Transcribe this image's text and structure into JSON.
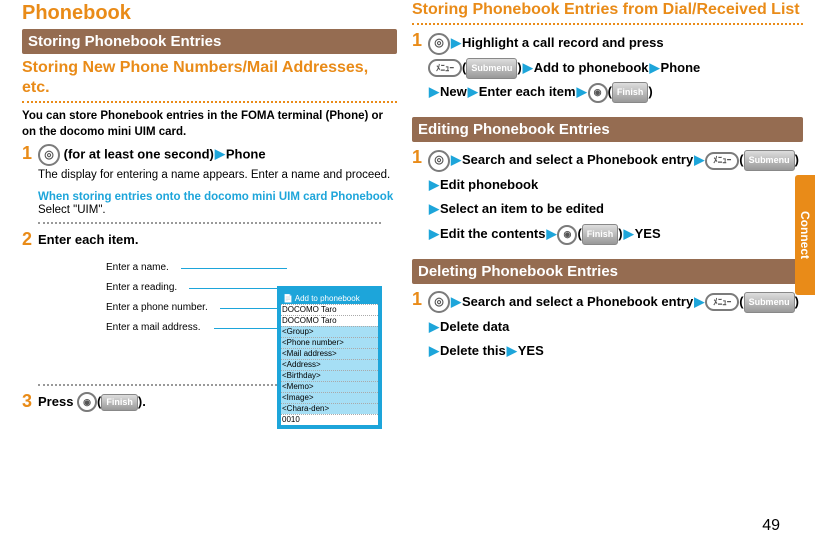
{
  "sidebar_label": "Connect",
  "page_number": "49",
  "left": {
    "h_phonebook": "Phonebook",
    "h_storing": "Storing Phonebook Entries",
    "h_storingnew": "Storing New Phone Numbers/Mail Addresses, etc.",
    "intro": "You can store Phonebook entries in the FOMA terminal (Phone) or on the docomo mini UIM card.",
    "step1_a": "(for at least one second)",
    "step1_b": "Phone",
    "step1_note": "The display for entering a name appears. Enter a name and proceed.",
    "bluehead": "When storing entries onto the docomo mini UIM card Phonebook",
    "bluenote": "Select \"UIM\".",
    "step2": "Enter each item.",
    "step3_a": "Press",
    "step3_b": "(",
    "step3_c": ").",
    "labels": {
      "name": "Enter a name.",
      "reading": "Enter a reading.",
      "phone": "Enter a phone number.",
      "mail": "Enter a mail address."
    },
    "screen": {
      "title": "Add to phonebook",
      "r1": "DOCOMO Taro",
      "r2": "DOCOMO Taro",
      "r3": "<Group>",
      "r4": "<Phone number>",
      "r5": "<Mail address>",
      "r6": "<Address>",
      "r7": "<Birthday>",
      "r8": "<Memo>",
      "r9": "<Image>",
      "r10": "<Chara-den>",
      "r11": "0010"
    },
    "finish": "Finish"
  },
  "right": {
    "h_dial": "Storing Phonebook Entries from Dial/Received List",
    "s1a": "Highlight a call record and press",
    "s1b": "(",
    "s1c": ")",
    "s1d": "Add to phonebook",
    "s1e": "Phone",
    "s1f": "New",
    "s1g": "Enter each item",
    "s1h": "(",
    "s1i": ")",
    "h_edit": "Editing Phonebook Entries",
    "e1": "Search and select a Phonebook entry",
    "e2": "(",
    "e3": ")",
    "e4": "Edit phonebook",
    "e5": "Select an item to be edited",
    "e6": "Edit the contents",
    "e7": "(",
    "e8": ")",
    "e9": "YES",
    "h_delete": "Deleting Phonebook Entries",
    "d1": "Search and select a Phonebook entry",
    "d2": "(",
    "d3": ")",
    "d4": "Delete data",
    "d5": "Delete this",
    "d6": "YES",
    "submenu": "Submenu",
    "menu": "ﾒﾆｭｰ",
    "finish": "Finish",
    "cam": "◉"
  }
}
